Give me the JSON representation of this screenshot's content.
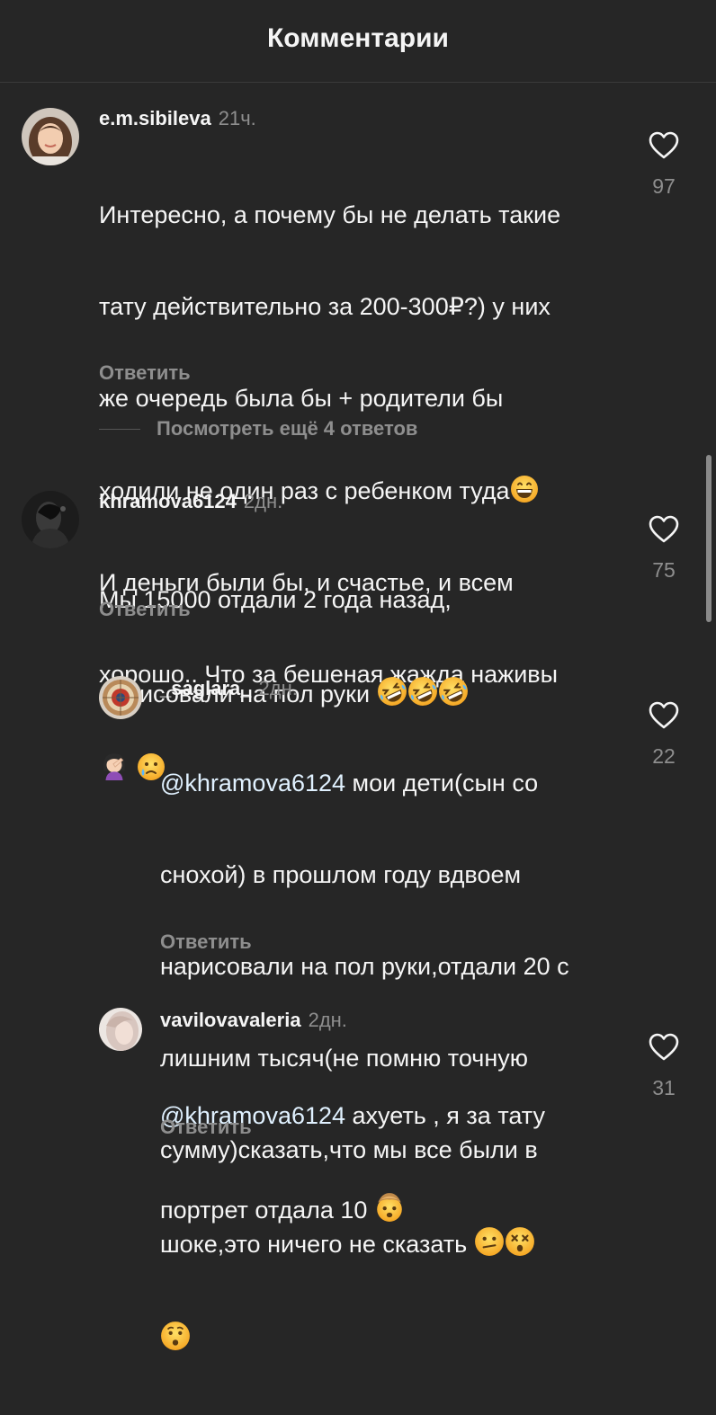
{
  "header": {
    "title": "Комментарии"
  },
  "comments": [
    {
      "username": "e.m.sibileva",
      "time": "21ч.",
      "lines": [
        "Интересно, а почему бы не делать такие",
        "тату действительно за 200-300₽?) у них",
        "же очередь была бы + родители бы",
        "ходили не один раз с ребенком туда",
        "И деньги были бы, и счастье, и всем",
        "хорошо.. Что за бешеная жажда наживы"
      ],
      "likes": "97",
      "reply_label": "Ответить",
      "more_replies": "Посмотреть ещё 4 ответов"
    },
    {
      "username": "khramova6124",
      "time": "2дн.",
      "lines": [
        "Мы 15000 отдали 2 года назад,",
        "нарисовали на пол руки"
      ],
      "likes": "75",
      "reply_label": "Ответить"
    },
    {
      "username": "_saglara_",
      "time": "2дн.",
      "mention": "@khramova6124",
      "lines": [
        " мои дети(сын со",
        "снохой) в прошлом году вдвоем",
        "нарисовали на пол руки,отдали 20 с",
        "лишним тысяч(не помню точную",
        "сумму)сказать,что мы все были в",
        "шоке,это ничего не сказать"
      ],
      "likes": "22",
      "reply_label": "Ответить"
    },
    {
      "username": "vavilovavaleria",
      "time": "2дн.",
      "mention": "@khramova6124",
      "lines": [
        " ахуеть , я за тату",
        "портрет отдала 10"
      ],
      "likes": "31",
      "reply_label": "Ответить"
    }
  ],
  "icons": {
    "heart": "heart-outline-icon",
    "emoji_grin": "grinning-emoji",
    "emoji_facepalm": "facepalm-emoji",
    "emoji_cry": "crying-emoji",
    "emoji_rofl": "rofl-emoji",
    "emoji_confused": "confused-emoji",
    "emoji_dizzy": "dizzy-emoji",
    "emoji_surprised": "surprised-emoji",
    "emoji_mindblown": "mind-blown-emoji"
  },
  "colors": {
    "background": "#262626",
    "text": "#f5f5f5",
    "secondary": "#8e8e8e",
    "mention": "#e0f1ff",
    "emoji_yellow": "#fcc21b"
  }
}
